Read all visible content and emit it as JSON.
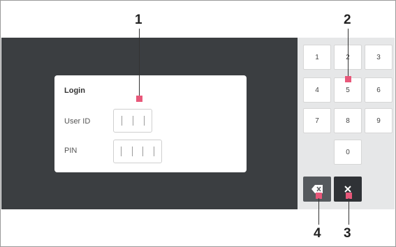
{
  "login": {
    "title": "Login",
    "user_id_label": "User ID",
    "pin_label": "PIN"
  },
  "keypad": {
    "keys": [
      "1",
      "2",
      "3",
      "4",
      "5",
      "6",
      "7",
      "8",
      "9",
      "0"
    ],
    "backspace_icon": "backspace-icon",
    "clear_icon": "close-icon"
  },
  "callouts": [
    "1",
    "2",
    "3",
    "4"
  ],
  "colors": {
    "screen_bg": "#3b3e41",
    "keypad_bg": "#e6e7e8",
    "marker": "#e8587a",
    "dark_key": "#55595d"
  }
}
